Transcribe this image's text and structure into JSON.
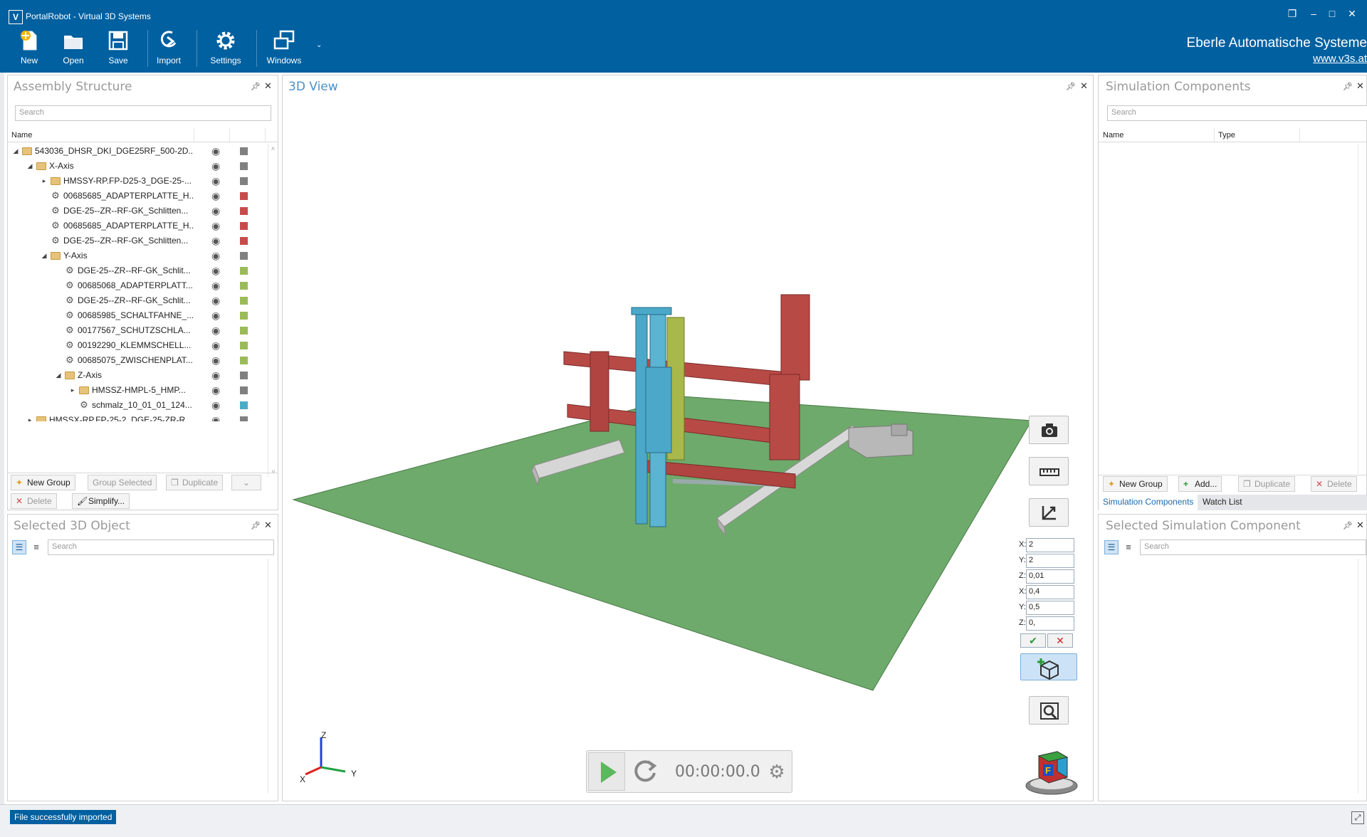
{
  "window": {
    "title": "PortalRobot - Virtual 3D Systems",
    "logo": "V",
    "controls": [
      "restore-icon",
      "minimize-icon",
      "maximize-icon",
      "close-icon"
    ]
  },
  "toolbar": {
    "new": "New",
    "open": "Open",
    "save": "Save",
    "import": "Import",
    "settings": "Settings",
    "windows": "Windows"
  },
  "branding": {
    "company": "Eberle Automatische Systeme",
    "website": "www.v3s.at"
  },
  "assembly": {
    "title": "Assembly Structure",
    "search_placeholder": "Search",
    "col_name": "Name",
    "rows": [
      {
        "label": "543036_DHSR_DKI_DGE25RF_500-2D...",
        "type": "folder",
        "level": 0,
        "arrow": "expanded",
        "color": "#808080"
      },
      {
        "label": "X-Axis",
        "type": "folder",
        "level": 1,
        "arrow": "expanded",
        "color": "#808080"
      },
      {
        "label": "HMSSY-RP.FP-D25-3_DGE-25-...",
        "type": "folder",
        "level": 2,
        "arrow": "collapsed",
        "color": "#808080"
      },
      {
        "label": "00685685_ADAPTERPLATTE_H...",
        "type": "part",
        "level": 2,
        "arrow": "",
        "color": "#c84b4b"
      },
      {
        "label": "DGE-25--ZR--RF-GK_Schlitten...",
        "type": "part",
        "level": 2,
        "arrow": "",
        "color": "#c84b4b"
      },
      {
        "label": "00685685_ADAPTERPLATTE_H...",
        "type": "part",
        "level": 2,
        "arrow": "",
        "color": "#c84b4b"
      },
      {
        "label": "DGE-25--ZR--RF-GK_Schlitten...",
        "type": "part",
        "level": 2,
        "arrow": "",
        "color": "#c84b4b"
      },
      {
        "label": "Y-Axis",
        "type": "folder",
        "level": 2,
        "arrow": "expanded",
        "color": "#808080"
      },
      {
        "label": "DGE-25--ZR--RF-GK_Schlit...",
        "type": "part",
        "level": 3,
        "arrow": "",
        "color": "#9bbb59"
      },
      {
        "label": "00685068_ADAPTERPLATT...",
        "type": "part",
        "level": 3,
        "arrow": "",
        "color": "#9bbb59"
      },
      {
        "label": "DGE-25--ZR--RF-GK_Schlit...",
        "type": "part",
        "level": 3,
        "arrow": "",
        "color": "#9bbb59"
      },
      {
        "label": "00685985_SCHALTFAHNE_...",
        "type": "part",
        "level": 3,
        "arrow": "",
        "color": "#9bbb59"
      },
      {
        "label": "00177567_SCHUTZSCHLA...",
        "type": "part",
        "level": 3,
        "arrow": "",
        "color": "#9bbb59"
      },
      {
        "label": "00192290_KLEMMSCHELL...",
        "type": "part",
        "level": 3,
        "arrow": "",
        "color": "#9bbb59"
      },
      {
        "label": "00685075_ZWISCHENPLAT...",
        "type": "part",
        "level": 3,
        "arrow": "",
        "color": "#9bbb59"
      },
      {
        "label": "Z-Axis",
        "type": "folder",
        "level": 3,
        "arrow": "expanded",
        "color": "#808080"
      },
      {
        "label": "HMSSZ-HMPL-5_HMP...",
        "type": "folder",
        "level": 4,
        "arrow": "collapsed",
        "color": "#808080"
      },
      {
        "label": "schmalz_10_01_01_124...",
        "type": "part",
        "level": 4,
        "arrow": "",
        "color": "#4bacc6"
      },
      {
        "label": "HMSSX-RP.FP-25-2_DGE-25-ZR-R...",
        "type": "folder",
        "level": 1,
        "arrow": "collapsed",
        "color": "#808080"
      }
    ],
    "buttons": {
      "new_group": "New Group",
      "group_selected": "Group Selected",
      "duplicate": "Duplicate",
      "delete": "Delete",
      "simplify": "Simplify..."
    }
  },
  "selected3d": {
    "title": "Selected 3D Object",
    "search_placeholder": "Search"
  },
  "view3d": {
    "title": "3D View",
    "coords": [
      {
        "axis": "X:",
        "value": "2"
      },
      {
        "axis": "Y:",
        "value": "2"
      },
      {
        "axis": "Z:",
        "value": "0,01"
      },
      {
        "axis": "X:",
        "value": "0,4"
      },
      {
        "axis": "Y:",
        "value": "0,5"
      },
      {
        "axis": "Z:",
        "value": "0,"
      }
    ],
    "timer": "00:00:00.0",
    "axis_x": "X",
    "axis_y": "Y",
    "axis_z": "Z",
    "colors": {
      "floor": "#6eaa6b",
      "red": "#b84a46",
      "cyan": "#4ba8c8",
      "green": "#a8b84a",
      "gray": "#c8c8c8"
    }
  },
  "simcomp": {
    "title": "Simulation Components",
    "search_placeholder": "Search",
    "col_name": "Name",
    "col_type": "Type",
    "buttons": {
      "new_group": "New Group",
      "add": "Add...",
      "duplicate": "Duplicate",
      "delete": "Delete"
    },
    "tabs": [
      "Simulation Components",
      "Watch List"
    ]
  },
  "selsim": {
    "title": "Selected Simulation Component",
    "search_placeholder": "Search"
  },
  "status": {
    "message": "File successfully imported"
  }
}
